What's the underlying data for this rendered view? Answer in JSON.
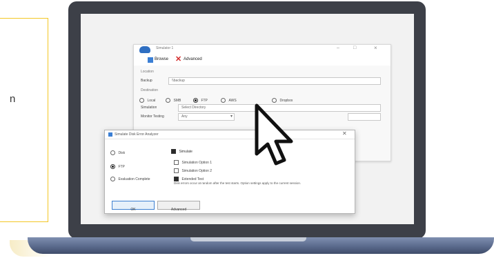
{
  "callout": {
    "partial_text": "n"
  },
  "backup_window": {
    "title": "Simulator 1",
    "toolbar": {
      "browse_label": "Browse",
      "advanced_label": "Advanced"
    },
    "section_label": "Location",
    "field_label": "Backup",
    "field_value": "\\\\backup",
    "method_label": "Destination",
    "radio_options": [
      "Local",
      "SMB",
      "FTP",
      "AWS",
      "Dropbox"
    ],
    "label2": "Simulation",
    "label3": "Monitor Testing",
    "value2": "Select Directory",
    "value3": "Any",
    "window_controls": [
      "–",
      "□",
      "×"
    ]
  },
  "dialog": {
    "title": "Simulate Disk Error Analyzer",
    "left_options": [
      "Disk",
      "FTP",
      "Evaluation Complete"
    ],
    "right_header": "Simulate",
    "right_options": [
      "Simulation Option 1",
      "Simulation Option 2",
      "Extended Test"
    ],
    "description": "Disk errors occur at random after the test starts. Option settings apply to the current session.",
    "ok_label": "OK",
    "cancel_label": "Advanced"
  }
}
